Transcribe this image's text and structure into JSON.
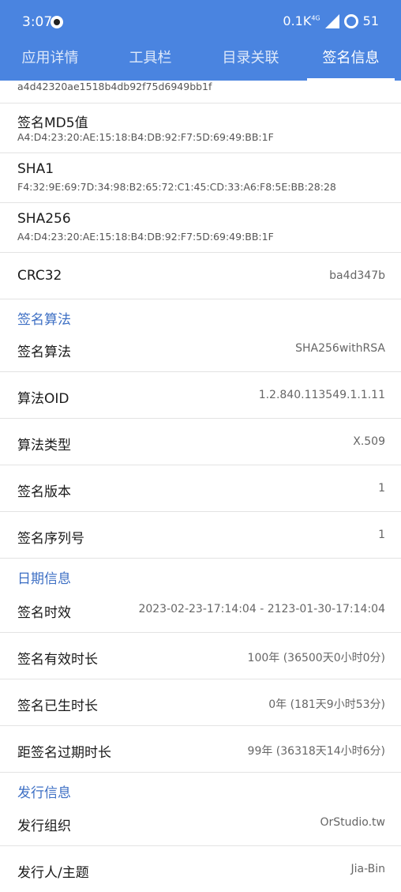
{
  "status_bar": {
    "time": "3:07",
    "net_speed": "0.1K",
    "net_type": "4G",
    "battery": "51"
  },
  "tabs": [
    "应用详情",
    "工具栏",
    "目录关联",
    "签名信息"
  ],
  "top_partial_text": "a4d42320ae1518b4db92f75d6949bb1f",
  "hash_rows": [
    {
      "label": "签名MD5值",
      "value": "A4:D4:23:20:AE:15:18:B4:DB:92:F7:5D:69:49:BB:1F"
    },
    {
      "label": "SHA1",
      "value": "F4:32:9E:69:7D:34:98:B2:65:72:C1:45:CD:33:A6:F8:5E:BB:28:28"
    },
    {
      "label": "SHA256",
      "value": "A4:D4:23:20:AE:15:18:B4:DB:92:F7:5D:69:49:BB:1F"
    }
  ],
  "crc32": {
    "label": "CRC32",
    "value": "ba4d347b"
  },
  "sections": {
    "algorithm": {
      "title": "签名算法",
      "rows": [
        {
          "label": "签名算法",
          "value": "SHA256withRSA"
        },
        {
          "label": "算法OID",
          "value": "1.2.840.113549.1.1.11"
        },
        {
          "label": "算法类型",
          "value": "X.509"
        },
        {
          "label": "签名版本",
          "value": "1"
        },
        {
          "label": "签名序列号",
          "value": "1"
        }
      ]
    },
    "date": {
      "title": "日期信息",
      "rows": [
        {
          "label": "签名时效",
          "value": "2023-02-23-17:14:04 - 2123-01-30-17:14:04"
        },
        {
          "label": "签名有效时长",
          "value": "100年 (36500天0小时0分)"
        },
        {
          "label": "签名已生时长",
          "value": "0年 (181天9小时53分)"
        },
        {
          "label": "距签名过期时长",
          "value": "99年 (36318天14小时6分)"
        }
      ]
    },
    "issuer": {
      "title": "发行信息",
      "rows": [
        {
          "label": "发行组织",
          "value": "OrStudio.tw"
        },
        {
          "label": "发行人/主题",
          "value": "Jia-Bin"
        }
      ]
    }
  },
  "colors": {
    "header": "#4a84e0",
    "section_title": "#3d6fc4",
    "divider": "#e3e3e3"
  }
}
